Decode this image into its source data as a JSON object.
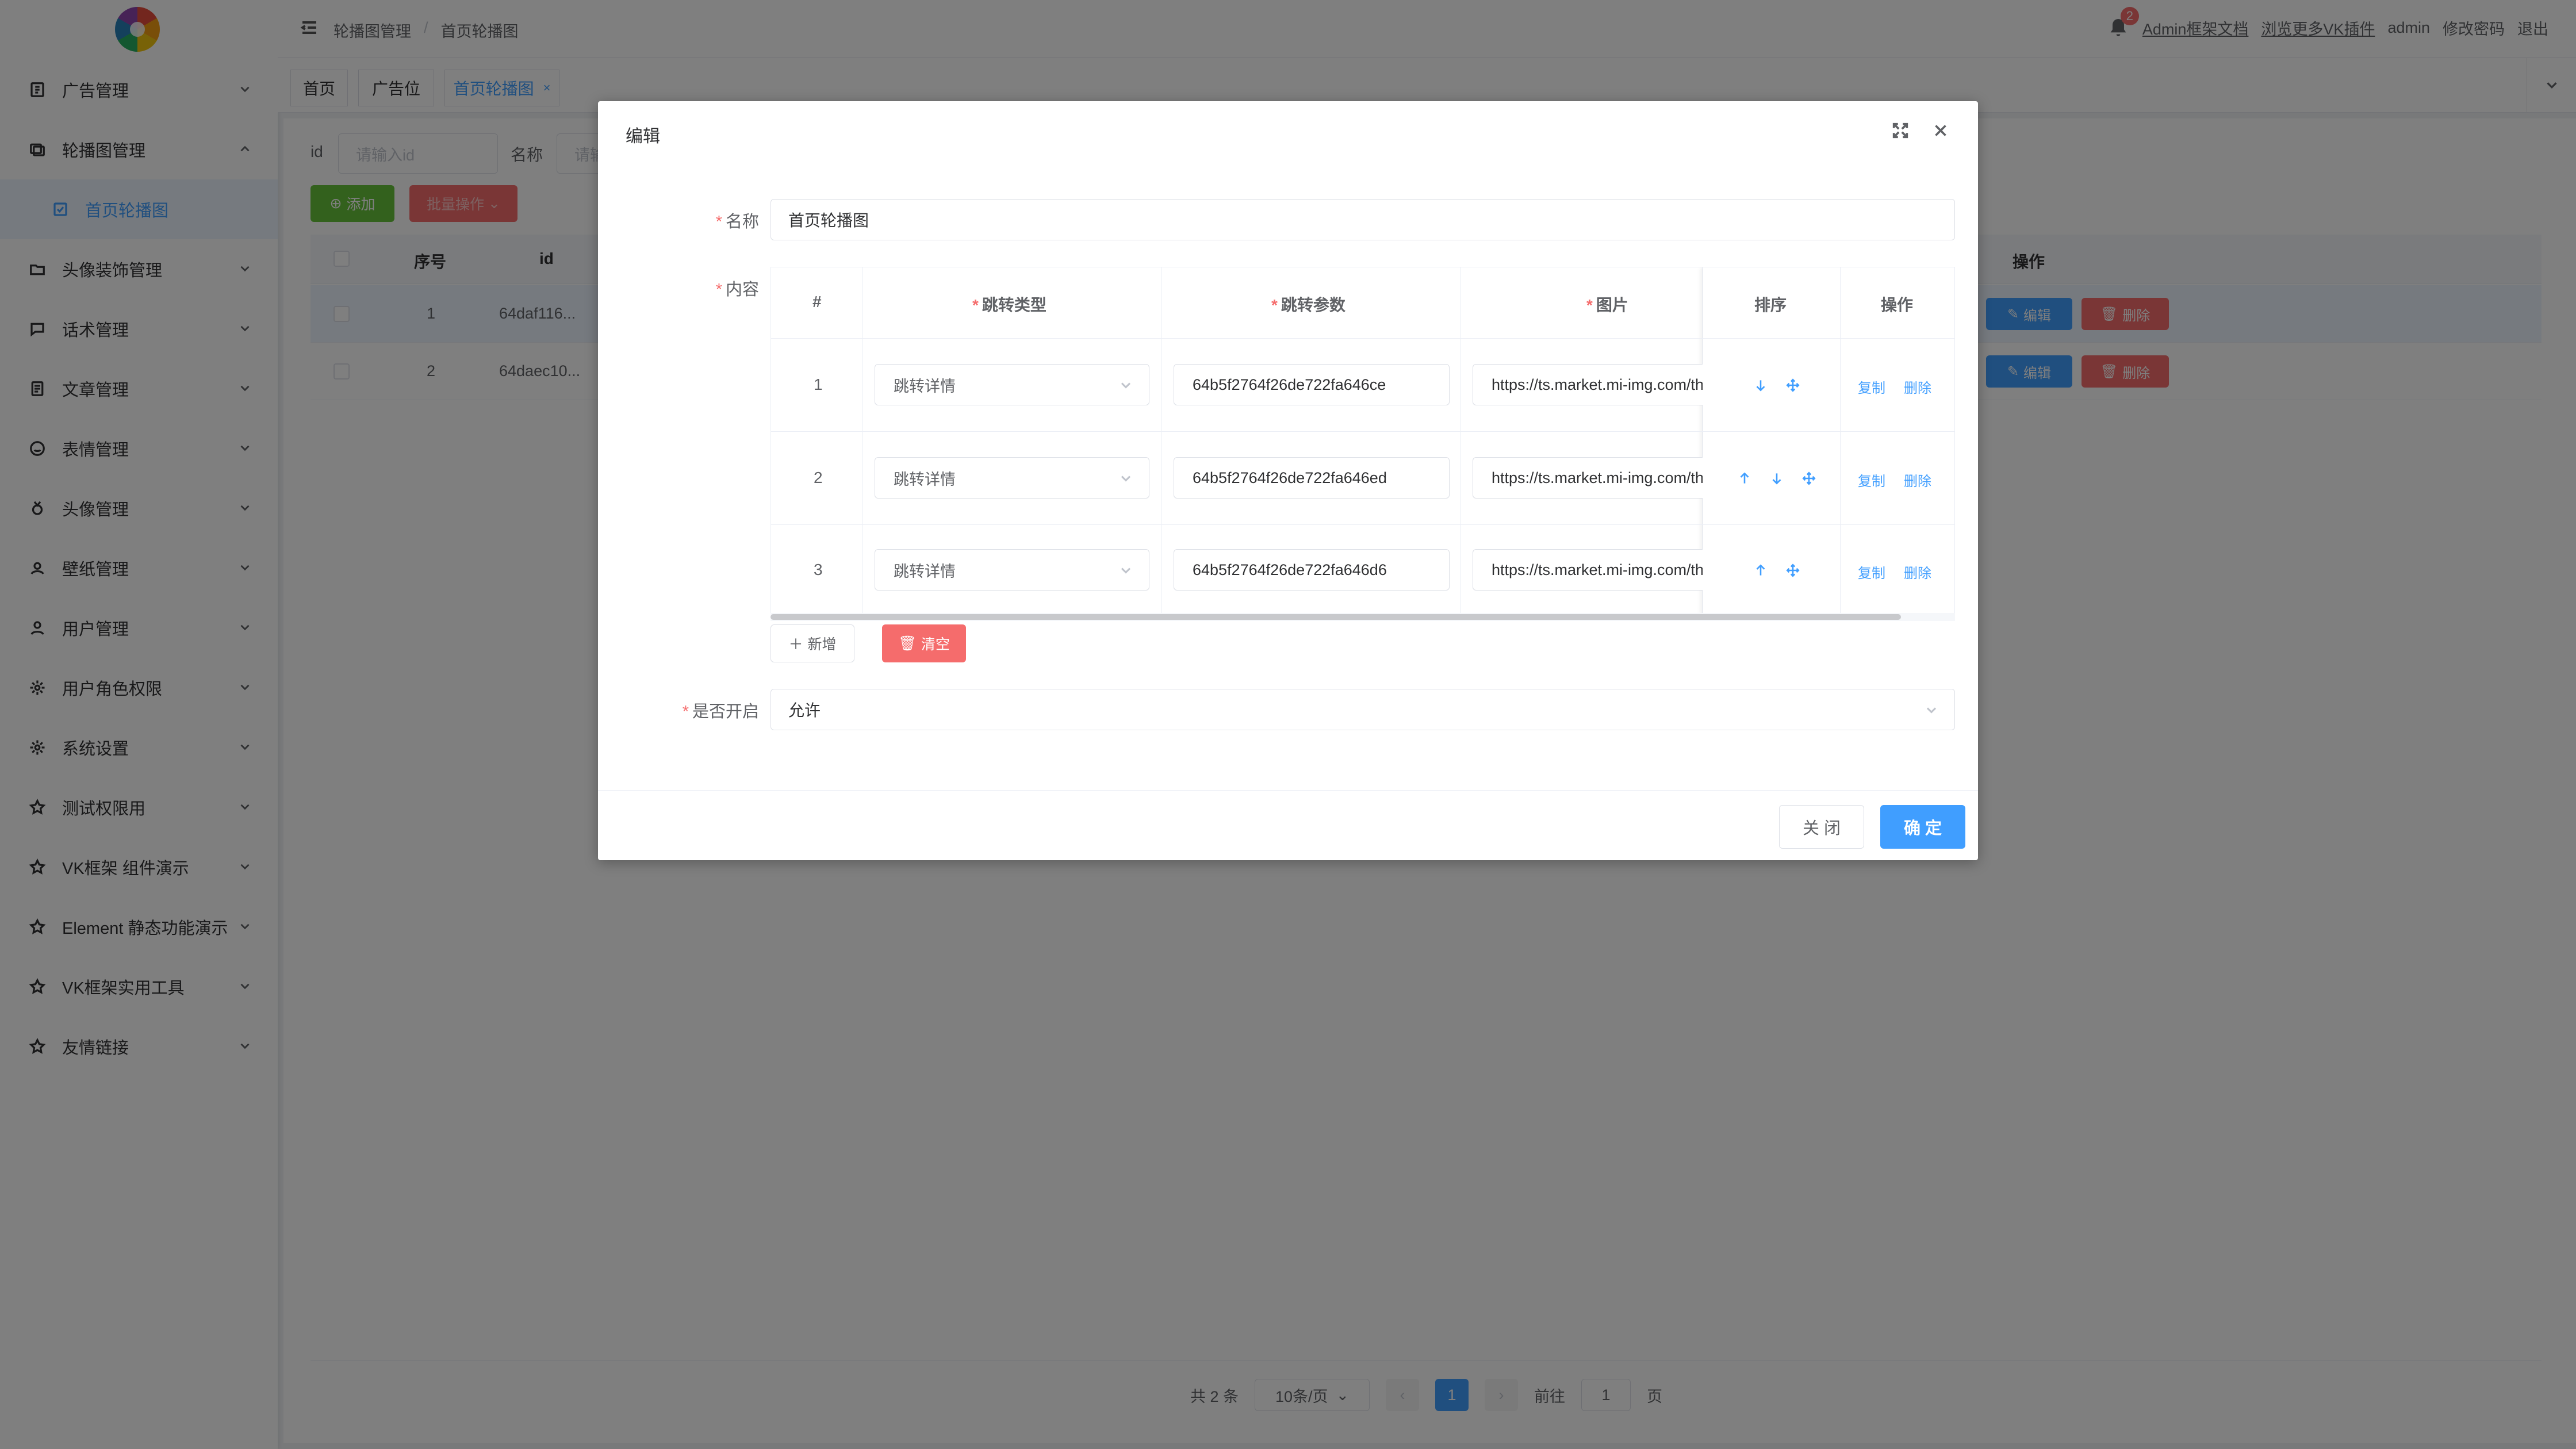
{
  "header": {
    "breadcrumb": [
      "轮播图管理",
      "首页轮播图"
    ],
    "notification_count": "2",
    "links": [
      "Admin框架文档",
      "浏览更多VK插件"
    ],
    "user": "admin",
    "change_password": "修改密码",
    "logout": "退出"
  },
  "sidebar": {
    "items": [
      {
        "label": "广告管理",
        "icon": "ad-icon"
      },
      {
        "label": "轮播图管理",
        "icon": "carousel-icon"
      },
      {
        "label": "首页轮播图",
        "icon": "checkbox-icon"
      },
      {
        "label": "头像装饰管理",
        "icon": "folder-icon"
      },
      {
        "label": "话术管理",
        "icon": "chat-icon"
      },
      {
        "label": "文章管理",
        "icon": "document-icon"
      },
      {
        "label": "表情管理",
        "icon": "smile-icon"
      },
      {
        "label": "头像管理",
        "icon": "medal-icon"
      },
      {
        "label": "壁纸管理",
        "icon": "picture-icon"
      },
      {
        "label": "用户管理",
        "icon": "user-icon"
      },
      {
        "label": "用户角色权限",
        "icon": "gear-icon"
      },
      {
        "label": "系统设置",
        "icon": "gear-icon"
      },
      {
        "label": "测试权限用",
        "icon": "star-icon"
      },
      {
        "label": "VK框架 组件演示",
        "icon": "star-icon"
      },
      {
        "label": "Element 静态功能演示",
        "icon": "star-icon"
      },
      {
        "label": "VK框架实用工具",
        "icon": "star-icon"
      },
      {
        "label": "友情链接",
        "icon": "star-icon"
      }
    ]
  },
  "tabs": [
    {
      "label": "首页"
    },
    {
      "label": "广告位"
    },
    {
      "label": "首页轮播图",
      "close": "×"
    }
  ],
  "search": {
    "id_label": "id",
    "id_placeholder": "请输入id",
    "name_label": "名称",
    "name_placeholder": "请输"
  },
  "toolbar": {
    "add": "添加",
    "batch": "批量操作"
  },
  "table": {
    "headers": [
      "序号",
      "id",
      "操作"
    ],
    "rows": [
      {
        "index": "1",
        "id": "64daf116..."
      },
      {
        "index": "2",
        "id": "64daec10..."
      }
    ],
    "edit": "编辑",
    "delete": "删除"
  },
  "pagination": {
    "total": "共 2 条",
    "page_size": "10条/页",
    "current_page": "1",
    "goto_prefix": "前往",
    "goto_value": "1",
    "goto_suffix": "页"
  },
  "modal": {
    "title": "编辑",
    "name_label": "名称",
    "name_value": "首页轮播图",
    "content_label": "内容",
    "columns": {
      "index": "#",
      "jump_type": "跳转类型",
      "jump_param": "跳转参数",
      "image": "图片",
      "sort": "排序",
      "ops": "操作"
    },
    "rows": [
      {
        "index": "1",
        "jump_type": "跳转详情",
        "jump_param": "64b5f2764f26de722fa646ce",
        "image": "https://ts.market.mi-img.com/thumbnail"
      },
      {
        "index": "2",
        "jump_type": "跳转详情",
        "jump_param": "64b5f2764f26de722fa646ed",
        "image": "https://ts.market.mi-img.com/thumbnail"
      },
      {
        "index": "3",
        "jump_type": "跳转详情",
        "jump_param": "64b5f2764f26de722fa646d6",
        "image": "https://ts.market.mi-img.com/thumbnail"
      }
    ],
    "copy": "复制",
    "delete": "删除",
    "add_row": "新增",
    "clear": "清空",
    "enable_label": "是否开启",
    "enable_value": "允许",
    "close_btn": "关 闭",
    "ok_btn": "确 定"
  },
  "colors": {
    "primary": "#409eff",
    "danger": "#f56c6c",
    "success": "#67c23a"
  }
}
